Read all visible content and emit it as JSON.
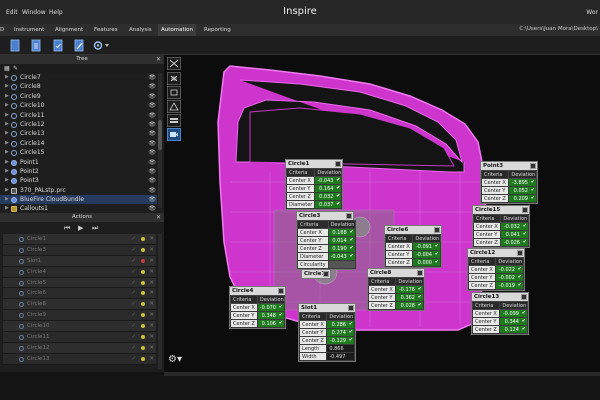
{
  "titlebar": {
    "title": "Inspire",
    "menu": [
      "Edit",
      "Window",
      "Help"
    ],
    "user": "Wor"
  },
  "ribbon": {
    "tabs": [
      "D",
      "Instrument",
      "Alignment",
      "Features",
      "Analysis",
      "Automation",
      "Reporting"
    ],
    "active_tab": "Automation",
    "path": "C:\\Users\\Juan Mora\\Desktop\\"
  },
  "tree": {
    "title": "Tree",
    "items": [
      {
        "label": "Circle7",
        "icon": "circle-feature-icon"
      },
      {
        "label": "Circle8",
        "icon": "circle-feature-icon"
      },
      {
        "label": "Circle9",
        "icon": "circle-feature-icon"
      },
      {
        "label": "Circle10",
        "icon": "circle-feature-icon"
      },
      {
        "label": "Circle11",
        "icon": "circle-feature-icon"
      },
      {
        "label": "Circle12",
        "icon": "circle-feature-icon"
      },
      {
        "label": "Circle13",
        "icon": "circle-feature-icon"
      },
      {
        "label": "Circle14",
        "icon": "circle-feature-icon"
      },
      {
        "label": "Circle15",
        "icon": "circle-feature-icon"
      },
      {
        "label": "Point1",
        "icon": "point-feature-icon"
      },
      {
        "label": "Point2",
        "icon": "point-feature-icon"
      },
      {
        "label": "Point3",
        "icon": "point-feature-icon"
      },
      {
        "label": "370_PALstp.prc",
        "icon": "cad-file-icon"
      },
      {
        "label": "BlueFire CloudBundle",
        "icon": "cloud-bundle-icon",
        "selected": true
      },
      {
        "label": "Callouts1",
        "icon": "folder-icon"
      }
    ]
  },
  "actions": {
    "title": "Actions",
    "items": [
      {
        "label": "Circle1",
        "status": "ok"
      },
      {
        "label": "Circle3",
        "status": "ok"
      },
      {
        "label": "Slot1",
        "status": "fail"
      },
      {
        "label": "Circle4",
        "status": "ok"
      },
      {
        "label": "Circle5",
        "status": "ok"
      },
      {
        "label": "Circle6",
        "status": "ok"
      },
      {
        "label": "Circle8",
        "status": "ok"
      },
      {
        "label": "Circle9",
        "status": "ok"
      },
      {
        "label": "Circle10",
        "status": "ok"
      },
      {
        "label": "Circle11",
        "status": "ok"
      },
      {
        "label": "Circle12",
        "status": "ok"
      },
      {
        "label": "Circle13",
        "status": "ok"
      }
    ]
  },
  "callouts": [
    {
      "id": "circle1",
      "title": "Circle1",
      "rows": [
        {
          "label": "Center X",
          "value": "-0.043",
          "status": "ok"
        },
        {
          "label": "Center Y",
          "value": "0.164",
          "status": "ok"
        },
        {
          "label": "Center Z",
          "value": "0.032",
          "status": "ok"
        },
        {
          "label": "Diameter",
          "value": "0.037",
          "status": "ok"
        }
      ]
    },
    {
      "id": "circle3",
      "title": "Circle3",
      "rows": [
        {
          "label": "Center X",
          "value": "0.188",
          "status": "ok"
        },
        {
          "label": "Center Y",
          "value": "0.014",
          "status": "ok"
        },
        {
          "label": "Center Z",
          "value": "0.190",
          "status": "ok"
        },
        {
          "label": "Diameter",
          "value": "-0.043",
          "status": "ok"
        },
        {
          "label": "Circularity",
          "value": "",
          "status": "dim"
        }
      ]
    },
    {
      "id": "circle4",
      "title": "Circle4",
      "rows": [
        {
          "label": "Center X",
          "value": "-0.070",
          "status": "ok"
        },
        {
          "label": "Center Y",
          "value": "0.348",
          "status": "ok"
        },
        {
          "label": "Center Z",
          "value": "0.106",
          "status": "ok"
        }
      ]
    },
    {
      "id": "slot1",
      "title": "Slot1",
      "rows": [
        {
          "label": "Center X",
          "value": "0.286",
          "status": "ok"
        },
        {
          "label": "Center Y",
          "value": "0.274",
          "status": "ok"
        },
        {
          "label": "Center Z",
          "value": "-0.129",
          "status": "ok"
        },
        {
          "label": "Length",
          "value": "0.866",
          "status": "fail"
        },
        {
          "label": "Width",
          "value": "-0.497",
          "status": "fail"
        }
      ]
    },
    {
      "id": "circle6",
      "title": "Circle6",
      "rows": [
        {
          "label": "Center X",
          "value": "-0.091",
          "status": "ok"
        },
        {
          "label": "Center Y",
          "value": "-0.004",
          "status": "ok"
        },
        {
          "label": "Center Z",
          "value": "0.000",
          "status": "ok"
        }
      ]
    },
    {
      "id": "circle8",
      "title": "Circle8",
      "rows": [
        {
          "label": "Center X",
          "value": "-0.176",
          "status": "ok"
        },
        {
          "label": "Center Y",
          "value": "0.362",
          "status": "ok"
        },
        {
          "label": "Center Z",
          "value": "0.028",
          "status": "ok"
        }
      ]
    },
    {
      "id": "circle7",
      "title": "Circle7",
      "rows": []
    },
    {
      "id": "point3",
      "title": "Point3",
      "rows": [
        {
          "label": "Center X",
          "value": "-3.895",
          "status": "ok"
        },
        {
          "label": "Center Y",
          "value": "0.052",
          "status": "ok"
        },
        {
          "label": "Center Z",
          "value": "0.209",
          "status": "ok"
        }
      ]
    },
    {
      "id": "circle15",
      "title": "Circle15",
      "rows": [
        {
          "label": "Center X",
          "value": "-0.032",
          "status": "ok"
        },
        {
          "label": "Center Y",
          "value": "0.041",
          "status": "ok"
        },
        {
          "label": "Center Z",
          "value": "-0.026",
          "status": "ok"
        }
      ]
    },
    {
      "id": "circle12",
      "title": "Circle12",
      "rows": [
        {
          "label": "Center X",
          "value": "-0.022",
          "status": "ok"
        },
        {
          "label": "Center Y",
          "value": "-0.002",
          "status": "ok"
        },
        {
          "label": "Center Z",
          "value": "-0.019",
          "status": "ok"
        }
      ]
    },
    {
      "id": "circle13",
      "title": "Circle13",
      "rows": [
        {
          "label": "Center X",
          "value": "-0.099",
          "status": "ok"
        },
        {
          "label": "Center Y",
          "value": "0.344",
          "status": "ok"
        },
        {
          "label": "Center Z",
          "value": "0.124",
          "status": "ok"
        }
      ]
    }
  ],
  "callout_headers": {
    "criteria": "Criteria",
    "deviation": "Deviation"
  },
  "colors": {
    "part": "#d23ad2",
    "ok": "#1f7a1f",
    "fail": "#a31818",
    "accent": "#1f4c80"
  }
}
